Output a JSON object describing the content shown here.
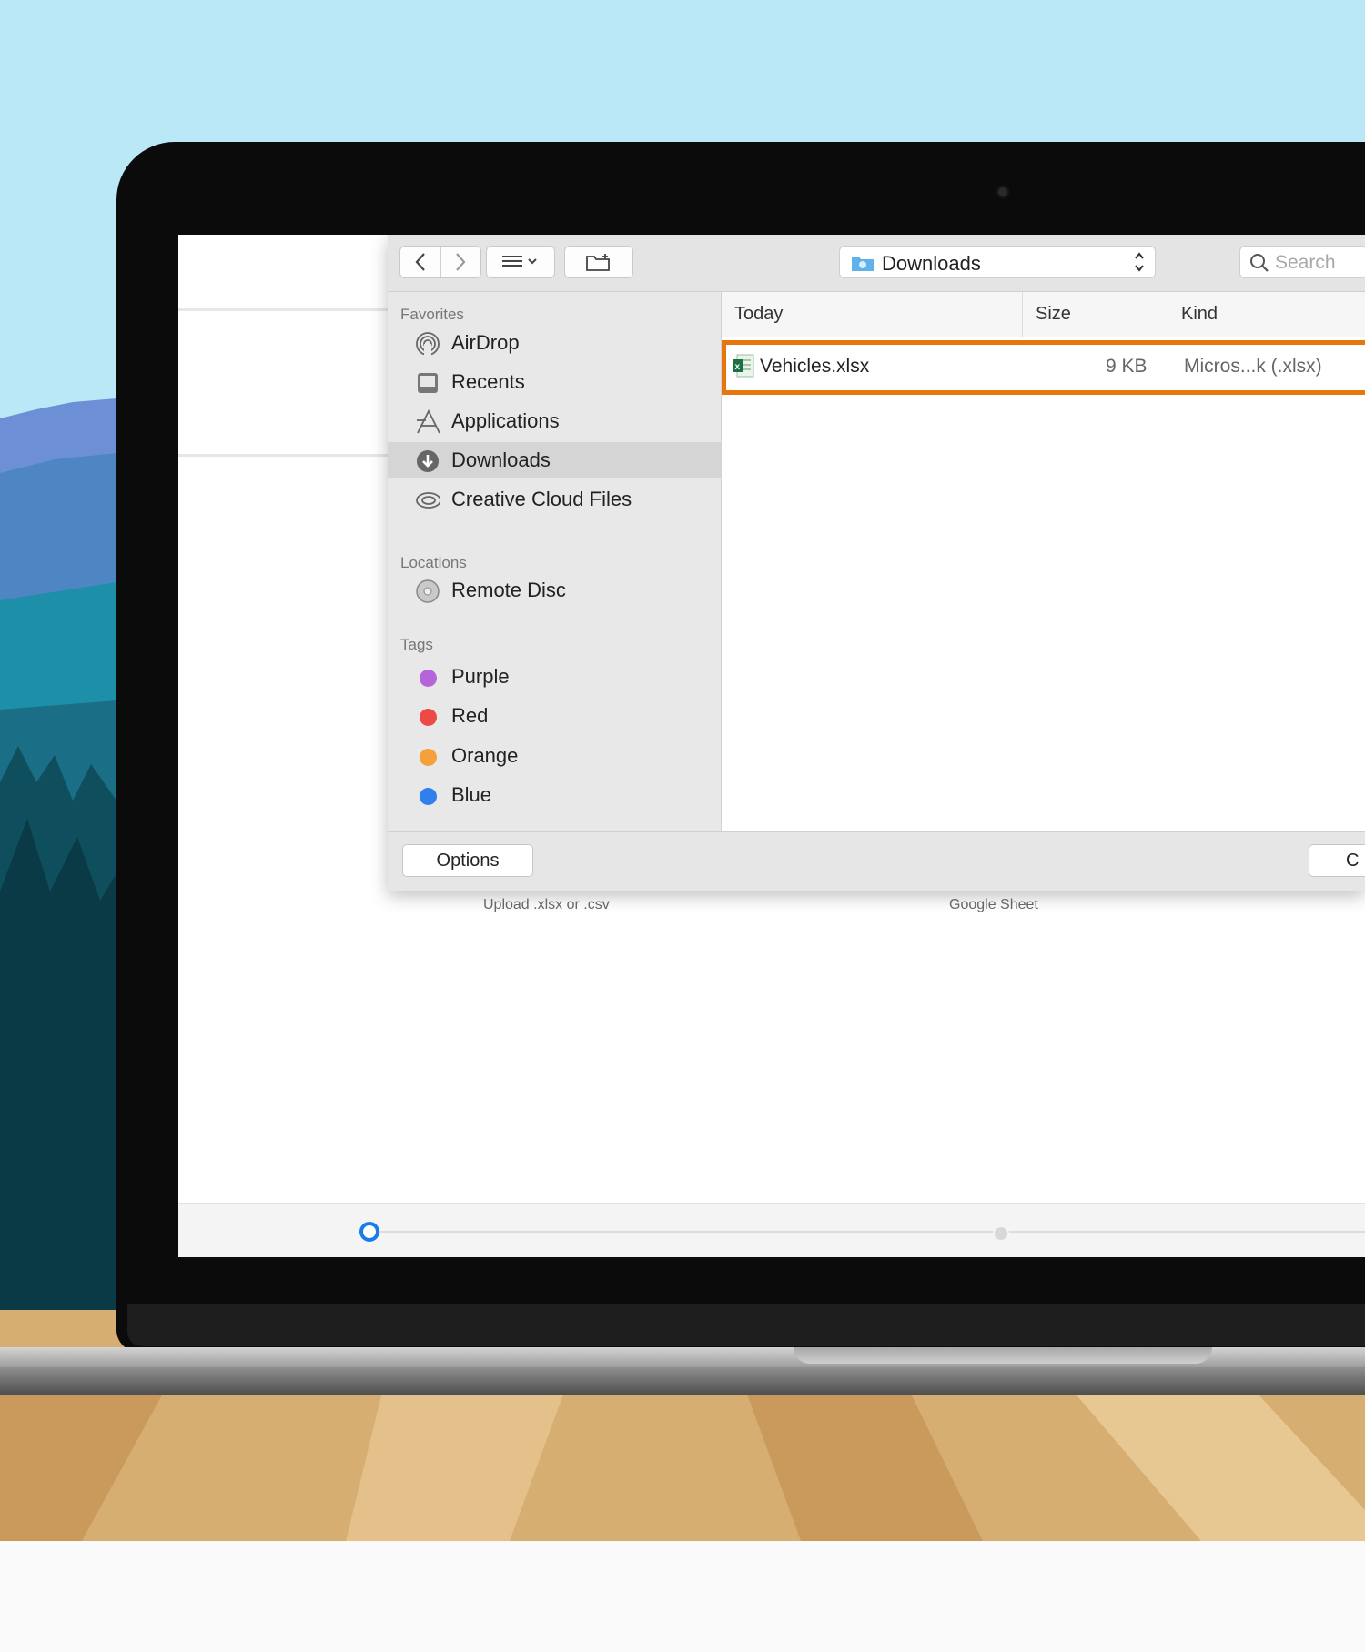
{
  "toolbar": {
    "location": "Downloads",
    "search_placeholder": "Search"
  },
  "sidebar": {
    "favorites_title": "Favorites",
    "favorites": [
      {
        "label": "AirDrop",
        "icon": "airdrop-icon"
      },
      {
        "label": "Recents",
        "icon": "recents-icon"
      },
      {
        "label": "Applications",
        "icon": "applications-icon"
      },
      {
        "label": "Downloads",
        "icon": "downloads-icon",
        "selected": true
      },
      {
        "label": "Creative Cloud Files",
        "icon": "creative-cloud-icon"
      }
    ],
    "locations_title": "Locations",
    "locations": [
      {
        "label": "Remote Disc",
        "icon": "disc-icon"
      }
    ],
    "tags_title": "Tags",
    "tags": [
      {
        "label": "Purple",
        "color": "#b565d9"
      },
      {
        "label": "Red",
        "color": "#ec4a45"
      },
      {
        "label": "Orange",
        "color": "#f5a03a"
      },
      {
        "label": "Blue",
        "color": "#2f80ed"
      }
    ]
  },
  "filelist": {
    "columns": [
      "Today",
      "Size",
      "Kind"
    ],
    "rows": [
      {
        "name": "Vehicles.xlsx",
        "size": "9 KB",
        "kind": "Micros...k (.xlsx)",
        "highlighted": true
      }
    ]
  },
  "footer": {
    "options_label": "Options",
    "cancel_label": "C"
  },
  "page": {
    "upload_label": "Upload .xlsx or .csv",
    "google_label": "Google Sheet"
  },
  "colors": {
    "highlight": "#e8760e",
    "step_active": "#1a7bea"
  }
}
